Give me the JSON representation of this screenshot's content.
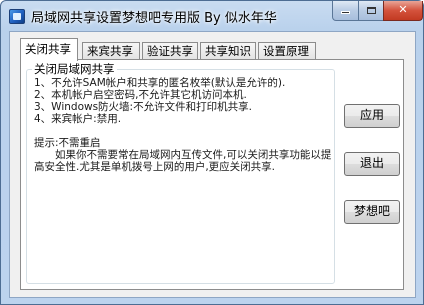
{
  "window": {
    "title": "局域网共享设置梦想吧专用版 By 似水年华"
  },
  "tabs": [
    {
      "label": "关闭共享"
    },
    {
      "label": "来宾共享"
    },
    {
      "label": "验证共享"
    },
    {
      "label": "共享知识"
    },
    {
      "label": "设置原理"
    }
  ],
  "panel": {
    "group_title": "关闭局域网共享",
    "lines": [
      "1、不允许SAM帐户和共享的匿名枚举(默认是允许的).",
      "2、本机帐户启空密码,不允许其它机访问本机.",
      "3、Windows防火墙:不允许文件和打印机共享.",
      "4、来宾帐户:禁用."
    ],
    "tip_title": "提示:不需重启",
    "tip_body": "如果你不需要常在局域网内互传文件,可以关闭共享功能以提高安全性.尤其是单机拨号上网的用户,更应关闭共享."
  },
  "buttons": {
    "apply": "应用",
    "exit": "退出",
    "dream": "梦想吧"
  }
}
